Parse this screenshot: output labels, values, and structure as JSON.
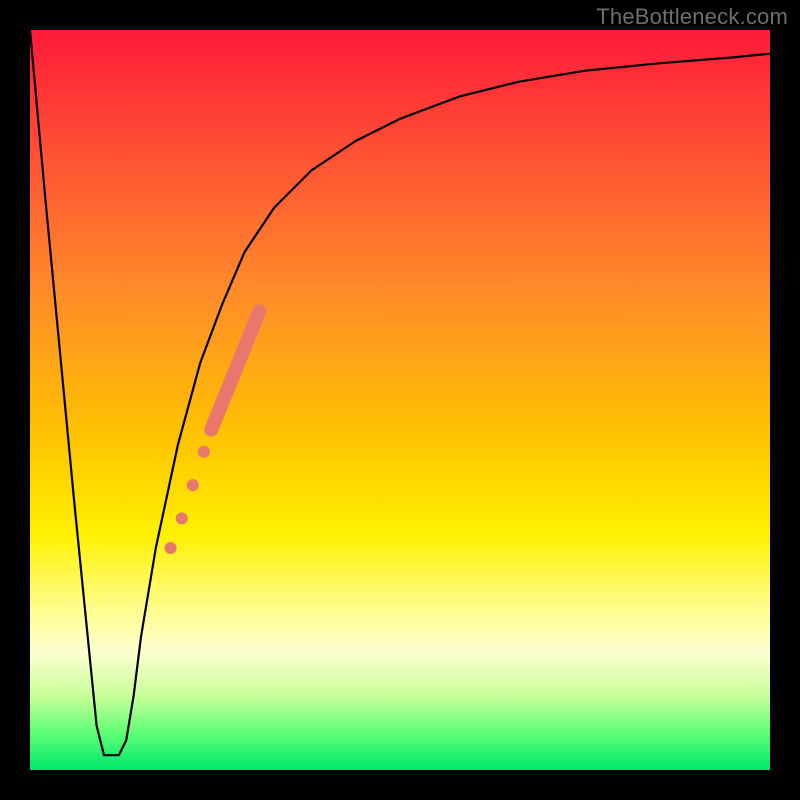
{
  "watermark": "TheBottleneck.com",
  "chart_data": {
    "type": "line",
    "title": "",
    "xlabel": "",
    "ylabel": "",
    "xlim": [
      0,
      100
    ],
    "ylim": [
      0,
      100
    ],
    "grid": false,
    "legend": false,
    "series": [
      {
        "name": "bottleneck-curve",
        "color": "#000000",
        "x": [
          0,
          2,
          4,
          6,
          8,
          9,
          10,
          11,
          12,
          13,
          14,
          15,
          17,
          20,
          23,
          26,
          29,
          33,
          38,
          44,
          50,
          58,
          66,
          75,
          85,
          95,
          100
        ],
        "y": [
          100,
          78,
          57,
          36,
          16,
          6,
          2,
          2,
          2,
          4,
          10,
          18,
          30,
          44,
          55,
          63,
          70,
          76,
          81,
          85,
          88,
          91,
          93,
          94.5,
          95.5,
          96.3,
          96.8
        ]
      }
    ],
    "highlight_points": {
      "name": "highlighted-range",
      "color": "#e9776d",
      "points": [
        {
          "x": 19.0,
          "y": 30.0,
          "r": 6
        },
        {
          "x": 20.5,
          "y": 34.0,
          "r": 6
        },
        {
          "x": 22.0,
          "y": 38.5,
          "r": 6
        },
        {
          "x": 23.5,
          "y": 43.0,
          "r": 6
        }
      ],
      "segment": {
        "x1": 24.5,
        "y1": 46.0,
        "x2": 31.0,
        "y2": 62.0
      }
    },
    "background_gradient": {
      "stops": [
        {
          "pos": 0.0,
          "color": "#ff1a3a"
        },
        {
          "pos": 0.18,
          "color": "#ff5533"
        },
        {
          "pos": 0.35,
          "color": "#ff8a2a"
        },
        {
          "pos": 0.55,
          "color": "#ffc300"
        },
        {
          "pos": 0.68,
          "color": "#fff000"
        },
        {
          "pos": 0.78,
          "color": "#fffd8a"
        },
        {
          "pos": 0.84,
          "color": "#fdffd0"
        },
        {
          "pos": 0.9,
          "color": "#c8ff9a"
        },
        {
          "pos": 0.95,
          "color": "#5eff76"
        },
        {
          "pos": 1.0,
          "color": "#00e66a"
        }
      ]
    }
  }
}
